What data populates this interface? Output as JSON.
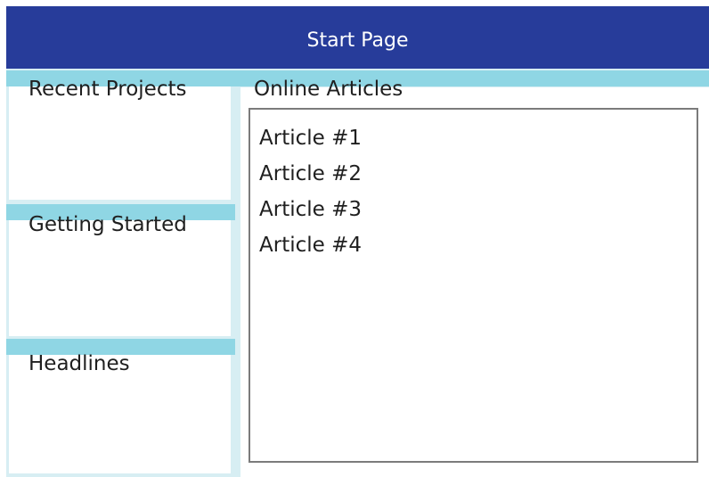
{
  "window": {
    "title": "Start Page"
  },
  "sidebar": {
    "sections": [
      {
        "label": "Recent Projects"
      },
      {
        "label": "Getting Started"
      },
      {
        "label": "Headlines"
      }
    ]
  },
  "main": {
    "articles_title": "Online Articles",
    "articles": [
      "Article #1",
      "Article #2",
      "Article #3",
      "Article #4"
    ]
  },
  "colors": {
    "titlebar": "#273c9a",
    "accent_band": "#8fd6e4",
    "background": "#d7eef3"
  }
}
